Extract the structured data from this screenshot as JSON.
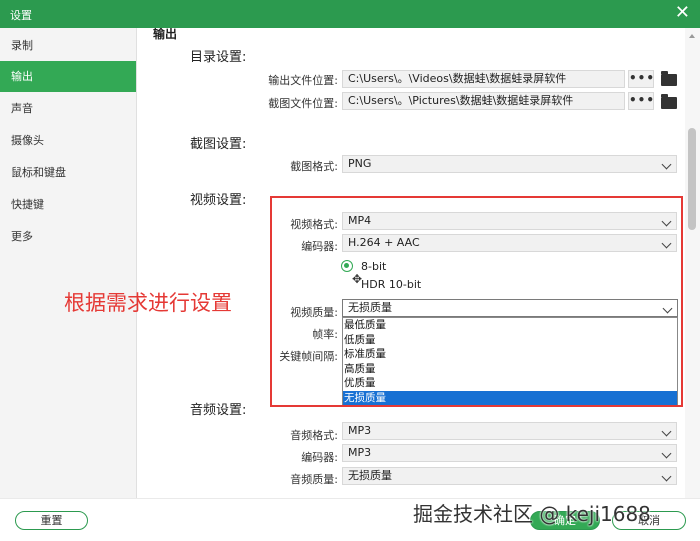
{
  "window": {
    "title": "设置",
    "close_glyph": "✕"
  },
  "sidebar": {
    "items": [
      {
        "label": "录制"
      },
      {
        "label": "输出",
        "active": true
      },
      {
        "label": "声音"
      },
      {
        "label": "摄像头"
      },
      {
        "label": "鼠标和键盘"
      },
      {
        "label": "快捷键"
      },
      {
        "label": "更多"
      }
    ]
  },
  "content": {
    "cut_heading": "输出",
    "directory": {
      "title": "目录设置:",
      "output_label": "输出文件位置:",
      "output_path": "C:\\Users\\。\\Videos\\数据蛙\\数据蛙录屏软件",
      "screenshot_label": "截图文件位置:",
      "screenshot_path": "C:\\Users\\。\\Pictures\\数据蛙\\数据蛙录屏软件",
      "browse_glyph": "•••",
      "icons": {
        "browse": "more-dots-icon",
        "folder": "folder-icon"
      }
    },
    "screenshot": {
      "title": "截图设置:",
      "format_label": "截图格式:",
      "format_value": "PNG"
    },
    "video": {
      "title": "视频设置:",
      "format_label": "视频格式:",
      "format_value": "MP4",
      "encoder_label": "编码器:",
      "encoder_value": "H.264 + AAC",
      "bit_8": "8-bit",
      "bit_10": "HDR 10-bit",
      "quality_label": "视频质量:",
      "quality_value": "无损质量",
      "fps_label": "帧率:",
      "keyframe_label": "关键帧间隔:",
      "quality_options": [
        "最低质量",
        "低质量",
        "标准质量",
        "高质量",
        "优质量",
        "无损质量"
      ],
      "quality_selected_index": 5
    },
    "audio": {
      "title": "音频设置:",
      "format_label": "音频格式:",
      "format_value": "MP3",
      "encoder_label": "编码器:",
      "encoder_value": "MP3",
      "quality_label": "音频质量:",
      "quality_value": "无损质量"
    }
  },
  "annotation": {
    "text": "根据需求进行设置"
  },
  "footer": {
    "reset_label": "重置",
    "ok_label": "确定",
    "cancel_label": "取消"
  },
  "watermark": {
    "text": "掘金技术社区 @ keji1688"
  },
  "colors": {
    "accent": "#33a955",
    "titlebar": "#2c9a4f",
    "annotation": "#e53935",
    "selection": "#1770d3"
  }
}
